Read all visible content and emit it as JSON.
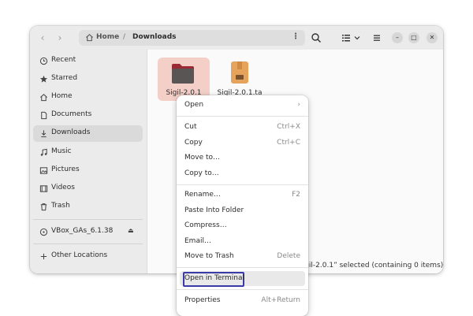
{
  "header": {
    "back_glyph": "‹",
    "forward_glyph": "›",
    "path_home": "Home",
    "path_separator": "/",
    "path_current": "Downloads",
    "path_menu_glyph": "⋮",
    "minimize_glyph": "–",
    "maximize_glyph": "□",
    "close_glyph": "✕",
    "icons": [
      "search-icon",
      "list-view-icon",
      "view-options-chevron-icon",
      "hamburger-menu-icon"
    ]
  },
  "sidebar": {
    "items": [
      {
        "label": "Recent",
        "icon": "clock-icon"
      },
      {
        "label": "Starred",
        "icon": "star-icon"
      },
      {
        "label": "Home",
        "icon": "home-icon"
      },
      {
        "label": "Documents",
        "icon": "document-icon"
      },
      {
        "label": "Downloads",
        "icon": "download-icon",
        "active": true
      },
      {
        "label": "Music",
        "icon": "music-icon"
      },
      {
        "label": "Pictures",
        "icon": "picture-icon"
      },
      {
        "label": "Videos",
        "icon": "video-icon"
      },
      {
        "label": "Trash",
        "icon": "trash-icon"
      }
    ],
    "mount": {
      "label": "VBox_GAs_6.1.38",
      "icon": "disc-icon",
      "eject_glyph": "⏏"
    },
    "other": {
      "label": "Other Locations",
      "icon": "plus-icon"
    }
  },
  "files": [
    {
      "name": "Sigil-2.0.1",
      "type": "folder",
      "selected": true
    },
    {
      "name": "Sigil-2.0.1.ta",
      "type": "archive"
    }
  ],
  "status": {
    "text": "Sigil-2.0.1” selected  (containing 0 items)"
  },
  "context_menu": {
    "open": {
      "label": "Open",
      "accel": "›"
    },
    "cut": {
      "label": "Cut",
      "accel": "Ctrl+X"
    },
    "copy": {
      "label": "Copy",
      "accel": "Ctrl+C"
    },
    "move_to": {
      "label": "Move to…"
    },
    "copy_to": {
      "label": "Copy to…"
    },
    "rename": {
      "label": "Rename…",
      "accel": "F2"
    },
    "paste_into": {
      "label": "Paste Into Folder"
    },
    "compress": {
      "label": "Compress…"
    },
    "email": {
      "label": "Email…"
    },
    "trash": {
      "label": "Move to Trash",
      "accel": "Delete"
    },
    "terminal": {
      "label": "Open in Terminal"
    },
    "properties": {
      "label": "Properties",
      "accel": "Alt+Return"
    }
  },
  "colors": {
    "selection_bg": "#f3cfc8",
    "folder": "#5a5555",
    "folder_tab": "#9a2a35",
    "archive": "#e6a35c",
    "focus_outline": "#3a3aa8"
  }
}
